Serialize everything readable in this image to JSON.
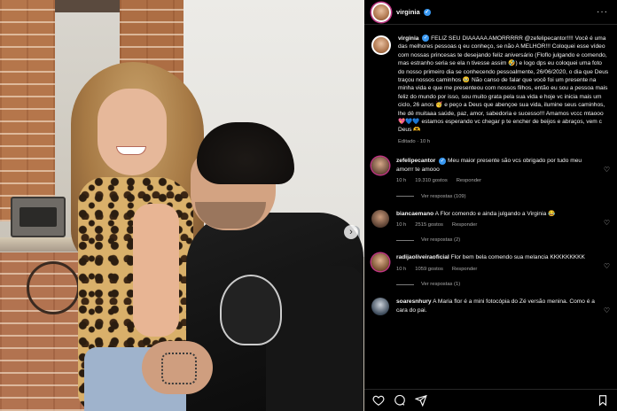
{
  "post": {
    "carousel_next_glyph": "›"
  },
  "panel": {
    "header": {
      "username": "virginia",
      "more_glyph": "···"
    },
    "caption": {
      "username": "virginia",
      "text": "FELIZ SEU DIAAAAA AMORRRRR @zefelipecantor!!!! Você é uma das melhores pessoas q eu conheço, se não A MELHOR!!! Coloquei esse vídeo com nossas princesas te desejando feliz aniversário (Floflo julgando e comendo, mas estranho seria se ela n tivesse assim 🤣) e logo dps eu coloquei uma foto do nosso primeiro dia se conhecendo pessoalmente, 26/06/2020, o dia que Deus traçou nossos caminhos 🥹 Não canso de falar que você foi um presente na minha vida e que me presenteou com nossos filhos, então eu sou a pessoa mais feliz do mundo por isso, sou muito grata pela sua vida e hoje vc inicia mais um ciclo, 26 anos 🥳 e peço a Deus que abençoe sua vida, ilumine seus caminhos, lhe dê muitaaa saúde, paz, amor, sabedoria e sucesso!!! Amamos vccc mtaooo 💖💙💙 estamos esperando vc chegar p te encher de beijos e abraços, vem c Deus 🫶",
      "meta": "Editado · 10 h"
    },
    "comments": [
      {
        "username": "zefelipecantor",
        "verified": true,
        "text": "Meu maior presente são vcs obrigado por tudo meu amorrr te amooo",
        "time": "10 h",
        "likes": "19.310 gostos",
        "reply": "Responder",
        "replies": "Ver respostas (109)"
      },
      {
        "username": "biancaemano",
        "verified": false,
        "text": "A Flor comendo e ainda julgando a Virginia 😂",
        "time": "10 h",
        "likes": "2515 gostos",
        "reply": "Responder",
        "replies": "Ver respostas (2)"
      },
      {
        "username": "radijaoliveiraoficial",
        "verified": false,
        "text": "Flor bem bela comendo sua melancia KKKKKKKKK",
        "time": "10 h",
        "likes": "1059 gostos",
        "reply": "Responder",
        "replies": "Ver respostas (1)"
      },
      {
        "username": "soaresnhury",
        "verified": false,
        "text": "A Maria flor é a mini fotocópia do Zé versão menina. Como é a cara do pai.",
        "time": "",
        "likes": "",
        "reply": "",
        "replies": ""
      }
    ]
  },
  "colors": {
    "background": "#000000",
    "text": "#f5f5f5",
    "muted": "#a8a8a8",
    "verified": "#3897f0"
  },
  "icons": [
    "heart-icon",
    "comment-icon",
    "share-icon",
    "bookmark-icon",
    "verified-badge-icon",
    "more-icon"
  ]
}
